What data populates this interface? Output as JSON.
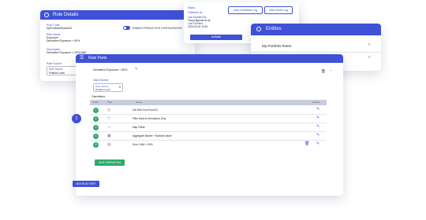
{
  "rule_details": {
    "title": "Rule Details",
    "rule_code_label": "Rule Code",
    "rule_code_value": "MyPortfolioRules002",
    "rule_name_label": "Rule Name",
    "rule_name_line1": "Exposure",
    "rule_name_line2": "Derivative Exposure > 50%",
    "description_label": "Description",
    "description_value": "Derivative Exposure > 20% NAV",
    "rule_source_label": "Rule Source",
    "rule_source_value1": "Rule Source",
    "rule_source_value2": "Position Level",
    "toggle_label": "ENABLE PRODUCTION CONFIGURATION"
  },
  "mid_card": {
    "line1": "Status",
    "line2": "Published for",
    "line3": "Last Modified By",
    "line4": "Tony.p@gmail.co.uk",
    "line5": "Last Modified",
    "line6": "2023-04-15 10:40",
    "workflow_button": "View Workflow Log",
    "audit_button": "View Audit Log",
    "action_button": "Activate"
  },
  "entities": {
    "title": "Entities",
    "items": [
      "My Portfolio Rules",
      ""
    ]
  },
  "rule_parts": {
    "title": "Rule Parts",
    "part_step": "1",
    "part_name": "Derivative Exposure > 50%",
    "data_source_label": "Data Source",
    "data_source_line1": "Rule Source",
    "data_source_line2": "Position Level",
    "operations_label": "Operations",
    "columns": [
      "Order",
      "Type",
      "Name",
      "Actions"
    ],
    "operations": [
      {
        "order": "1",
        "name": "Get NAV from Fund ID"
      },
      {
        "order": "2",
        "name": "Filter Data to Derivatives Only"
      },
      {
        "order": "3",
        "name": "Map Fields"
      },
      {
        "order": "4",
        "name": "Aggregate Market + Notional Value"
      },
      {
        "order": "5",
        "name": "Sum / NAV > 50%"
      }
    ],
    "add_operation_button": "ADD OPERATION",
    "add_rule_part_button": "ADD RULE PART"
  },
  "colors": {
    "primary": "#3f51d6",
    "success": "#2fa96b",
    "table_header": "#c9cddd"
  }
}
